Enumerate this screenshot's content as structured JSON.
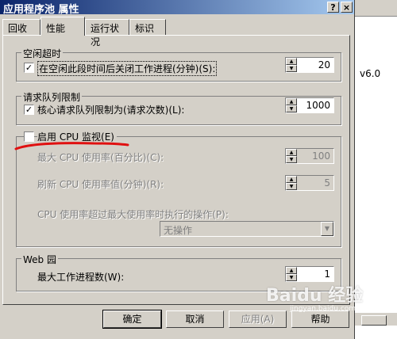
{
  "window": {
    "title": "应用程序池 属性",
    "help_btn": "?",
    "close_btn": "×"
  },
  "tabs": [
    {
      "label": "回收"
    },
    {
      "label": "性能"
    },
    {
      "label": "运行状况"
    },
    {
      "label": "标识"
    }
  ],
  "idle": {
    "group_label": "空闲超时",
    "checkbox_label": "在空闲此段时间后关闭工作进程(分钟)(S):",
    "checked": true,
    "value": "20"
  },
  "queue": {
    "group_label": "请求队列限制",
    "checkbox_label": "核心请求队列限制为(请求次数)(L):",
    "checked": true,
    "value": "1000"
  },
  "cpu": {
    "checkbox_label": "启用 CPU 监视(E)",
    "checked": false,
    "max_label": "最大 CPU 使用率(百分比)(C):",
    "max_value": "100",
    "refresh_label": "刷新 CPU 使用率值(分钟)(R):",
    "refresh_value": "5",
    "action_label": "CPU 使用率超过最大使用率时执行的操作(P):",
    "action_value": "无操作"
  },
  "web_garden": {
    "group_label": "Web 园",
    "label": "最大工作进程数(W):",
    "value": "1"
  },
  "buttons": {
    "ok": "确定",
    "cancel": "取消",
    "apply": "应用(A)",
    "help": "帮助"
  },
  "background": {
    "text": "v6.0"
  },
  "watermark": {
    "text": "Baidu 经验",
    "url": "jingyan.baidu.com"
  },
  "colors": {
    "titlebar_start": "#0a246a",
    "titlebar_end": "#a6caf0",
    "annotation_red": "#e01010"
  }
}
